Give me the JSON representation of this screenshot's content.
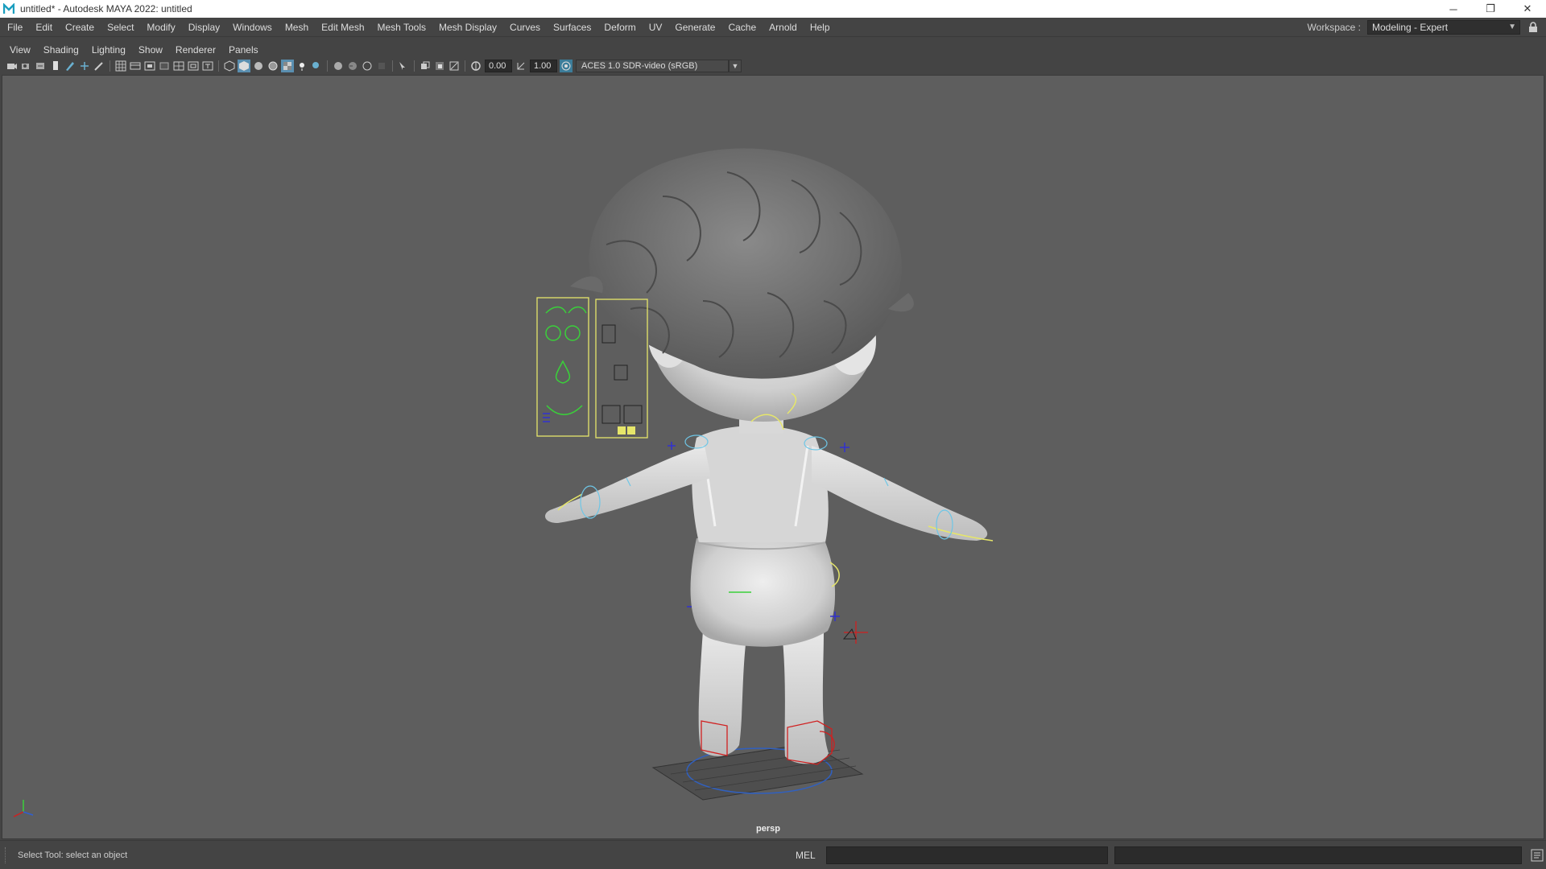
{
  "window": {
    "title": "untitled* - Autodesk MAYA 2022: untitled",
    "controls": {
      "minimize": "─",
      "restore": "❐",
      "close": "✕"
    }
  },
  "menubar": {
    "items": [
      "File",
      "Edit",
      "Create",
      "Select",
      "Modify",
      "Display",
      "Windows",
      "Mesh",
      "Edit Mesh",
      "Mesh Tools",
      "Mesh Display",
      "Curves",
      "Surfaces",
      "Deform",
      "UV",
      "Generate",
      "Cache",
      "Arnold",
      "Help"
    ]
  },
  "workspace": {
    "label": "Workspace :",
    "value": "Modeling - Expert"
  },
  "panel_menu": {
    "items": [
      "View",
      "Shading",
      "Lighting",
      "Show",
      "Renderer",
      "Panels"
    ]
  },
  "toolbar": {
    "exposure": "0.00",
    "gamma": "1.00",
    "color_space": "ACES 1.0 SDR-video (sRGB)"
  },
  "viewport": {
    "camera_label": "persp"
  },
  "statusbar": {
    "message": "Select Tool: select an object",
    "script_type": "MEL"
  },
  "colors": {
    "viewport_bg": "#5e5e5e",
    "ui_bg": "#444444",
    "control_yellow": "#e6e66a",
    "control_green": "#3ad03a",
    "control_cyan": "#6ec6e6",
    "control_red": "#d02020",
    "control_blue": "#3030d0"
  }
}
